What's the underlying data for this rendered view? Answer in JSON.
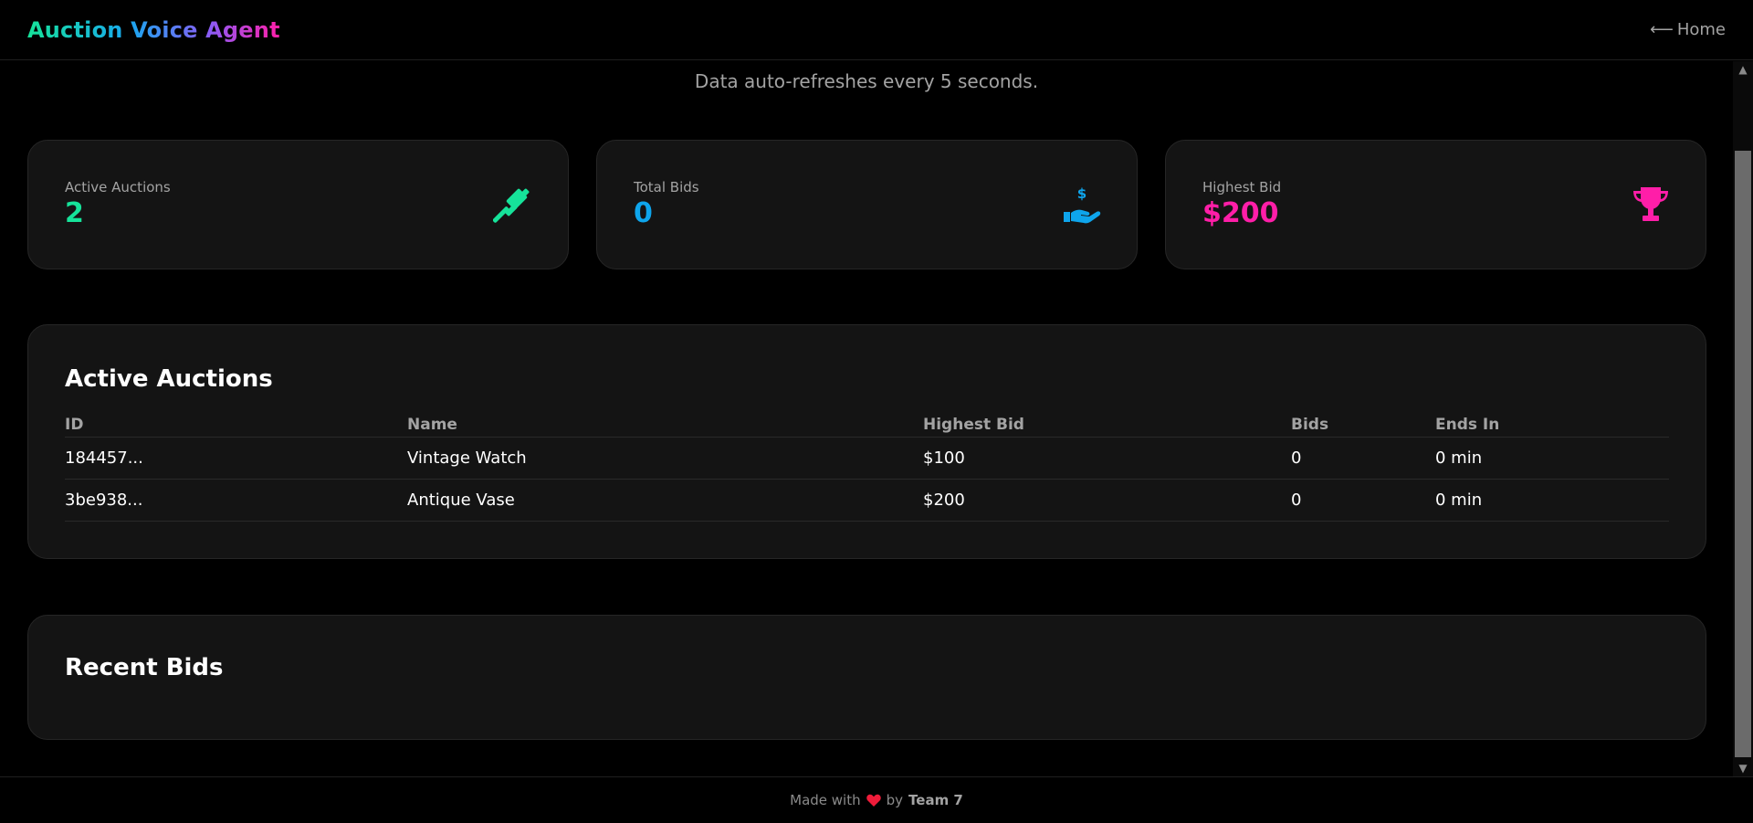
{
  "header": {
    "brand": "Auction Voice Agent",
    "home_arrow": "⟵",
    "home_label": "Home"
  },
  "subtitle": "Data auto-refreshes every 5 seconds.",
  "stats": [
    {
      "label": "Active Auctions",
      "value": "2",
      "color": "#16e39a",
      "icon": "gavel-icon"
    },
    {
      "label": "Total Bids",
      "value": "0",
      "color": "#0ea5ec",
      "icon": "hand-dollar-icon"
    },
    {
      "label": "Highest Bid",
      "value": "$200",
      "color": "#ff1ea8",
      "icon": "trophy-icon"
    }
  ],
  "active_auctions": {
    "title": "Active Auctions",
    "columns": {
      "id": "ID",
      "name": "Name",
      "highest_bid": "Highest Bid",
      "bids": "Bids",
      "ends_in": "Ends In"
    },
    "rows": [
      {
        "id": "184457...",
        "name": "Vintage Watch",
        "highest_bid": "$100",
        "bids": "0",
        "ends_in": "0 min"
      },
      {
        "id": "3be938...",
        "name": "Antique Vase",
        "highest_bid": "$200",
        "bids": "0",
        "ends_in": "0 min"
      }
    ]
  },
  "recent_bids": {
    "title": "Recent Bids"
  },
  "footer": {
    "prefix": "Made with",
    "heart_icon": "heart-icon",
    "by": "by",
    "team": "Team 7"
  },
  "colors": {
    "background": "#000000",
    "card": "#141414",
    "heart": "#ef1c3a"
  }
}
